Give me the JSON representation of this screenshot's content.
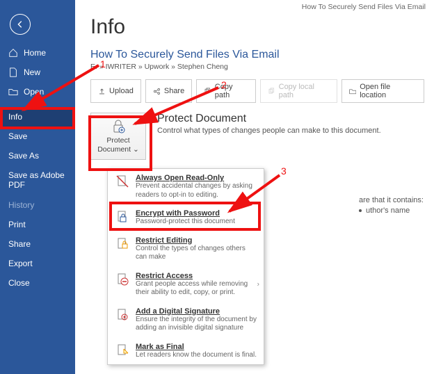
{
  "window_title": "How To Securely Send Files Via Email",
  "page_title": "Info",
  "doc_title": "How To Securely Send Files Via Email",
  "breadcrumb": "E: » IWRITER » Upwork » Stephen Cheng",
  "sidebar": {
    "items": [
      {
        "label": "Home",
        "icon": "home"
      },
      {
        "label": "New",
        "icon": "new"
      },
      {
        "label": "Open",
        "icon": "open"
      },
      {
        "label": "Info"
      },
      {
        "label": "Save"
      },
      {
        "label": "Save As"
      },
      {
        "label": "Save as Adobe PDF"
      },
      {
        "label": "History",
        "disabled": true
      },
      {
        "label": "Print"
      },
      {
        "label": "Share"
      },
      {
        "label": "Export"
      },
      {
        "label": "Close"
      }
    ]
  },
  "toolbar": [
    {
      "label": "Upload",
      "icon": "upload"
    },
    {
      "label": "Share",
      "icon": "share"
    },
    {
      "label": "Copy path",
      "icon": "copy"
    },
    {
      "label": "Copy local path",
      "icon": "copy",
      "disabled": true
    },
    {
      "label": "Open file location",
      "icon": "folder"
    }
  ],
  "protect_button": {
    "label": "Protect Document ⌄"
  },
  "section": {
    "title": "Protect Document",
    "desc": "Control what types of changes people can make to this document."
  },
  "dropdown": [
    {
      "title": "Always Open Read-Only",
      "sub": "Prevent accidental changes by asking readers to opt-in to editing.",
      "icon": "readonly"
    },
    {
      "title": "Encrypt with Password",
      "sub": "Password-protect this document",
      "icon": "encrypt",
      "highlighted": true
    },
    {
      "title": "Restrict Editing",
      "sub": "Control the types of changes others can make",
      "icon": "restrict-edit"
    },
    {
      "title": "Restrict Access",
      "sub": "Grant people access while removing their ability to edit, copy, or print.",
      "icon": "restrict-access",
      "submenu": true
    },
    {
      "title": "Add a Digital Signature",
      "sub": "Ensure the integrity of the document by adding an invisible digital signature",
      "icon": "signature"
    },
    {
      "title": "Mark as Final",
      "sub": "Let readers know the document is final.",
      "icon": "final"
    }
  ],
  "props": {
    "intro": "are that it contains:",
    "bullet": "uthor's name"
  },
  "annotations": {
    "n1": "1",
    "n2": "2",
    "n3": "3"
  }
}
